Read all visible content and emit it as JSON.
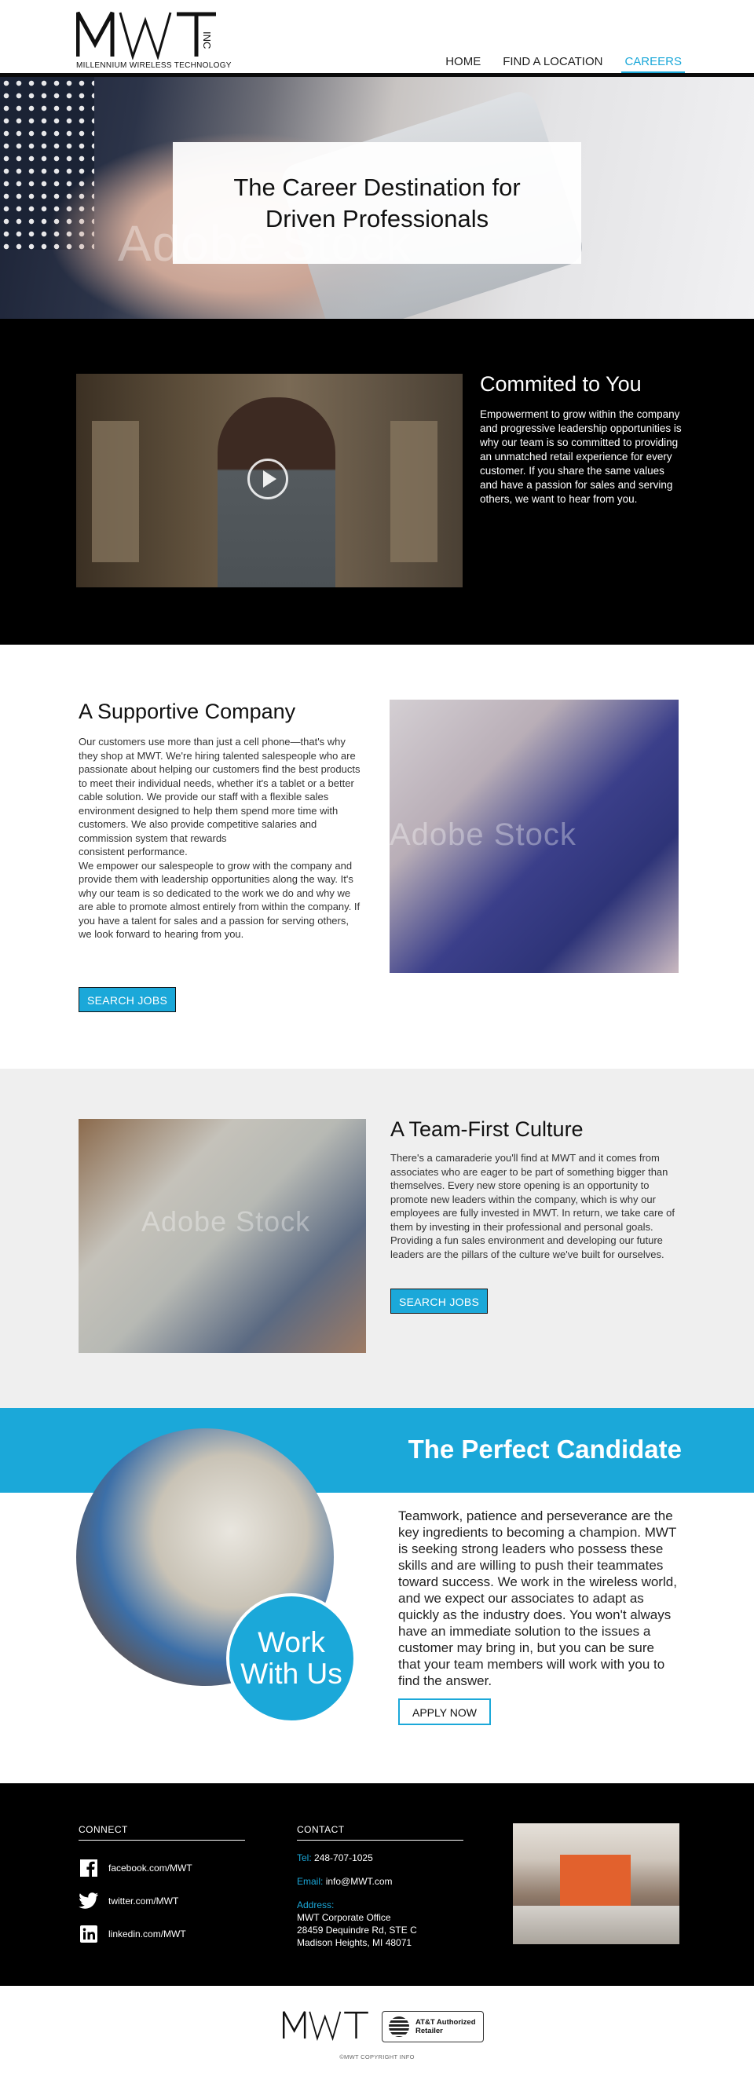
{
  "brand": {
    "logo_text": "MWT",
    "logo_inc": "INC",
    "logo_subtitle": "MILLENNIUM WIRELESS TECHNOLOGY",
    "accent_color": "#1ba8d9"
  },
  "nav": {
    "items": [
      {
        "label": "HOME",
        "active": false
      },
      {
        "label": "FIND A LOCATION",
        "active": false
      },
      {
        "label": "CAREERS",
        "active": true
      }
    ]
  },
  "hero": {
    "headline": "The Career Destination for Driven Professionals",
    "watermark": "Adobe Stock"
  },
  "committed": {
    "title": "Commited to You",
    "body": "Empowerment to grow within the company and progressive leadership opportunities is why our team is so committed to providing an unmatched retail experience for every customer. If you share the same values and have a passion for sales and serving others, we want to hear from you.",
    "video_icon": "play-icon"
  },
  "support": {
    "title": "A Supportive Company",
    "body_1": "Our customers use more than just a cell phone—that's why they shop at MWT. We're hiring talented salespeople who are passionate about helping our customers find the best products to meet their individual needs, whether it's a tablet or a better cable solution. We provide our staff with a flexible sales environment designed to help them spend more time with customers. We also provide competitive salaries and commission system that rewards",
    "body_2": "consistent performance.",
    "body_3": "We empower our salespeople to grow with the company and provide them with leadership opportunities along the way. It's why our team is so dedicated to the work we do and why we are able to promote almost entirely from within the company. If you have a talent for sales and a passion for serving others, we look forward to hearing from you.",
    "button": "SEARCH JOBS",
    "watermark": "Adobe Stock"
  },
  "team": {
    "title": "A Team-First Culture",
    "body": "There's a camaraderie you'll find at MWT and it comes from associates who are eager to be part of something bigger than themselves. Every new store opening is an opportunity to promote new leaders within the company, which is why our employees are fully invested in MWT. In return, we take care of them by investing in their professional and personal goals. Providing a fun sales environment and developing our future leaders are the pillars of the culture we've built for ourselves.",
    "button": "SEARCH JOBS",
    "watermark": "Adobe Stock"
  },
  "candidate": {
    "title": "The Perfect Candidate",
    "circle_text": "Work With Us",
    "body": "Teamwork, patience and perseverance are the key ingredients to becoming a champion. MWT is seeking strong leaders who possess these skills and are willing to push their teammates toward success. We work in the wireless world, and we expect our associates to adapt as quickly as the industry does. You won't always have an immediate solution to the issues a customer may bring in, but you can be sure that your team members will work with you to find the answer.",
    "button": "APPLY NOW"
  },
  "footer": {
    "connect_title": "CONNECT",
    "social": [
      {
        "icon": "facebook-icon",
        "label": "facebook.com/MWT"
      },
      {
        "icon": "twitter-icon",
        "label": "twitter.com/MWT"
      },
      {
        "icon": "linkedin-icon",
        "label": "linkedin.com/MWT"
      }
    ],
    "contact_title": "CONTACT",
    "tel_label": "Tel:",
    "tel": "248-707-1025",
    "email_label": "Email:",
    "email": "info@MWT.com",
    "address_label": "Address:",
    "address_1": "MWT Corporate Office",
    "address_2": "28459 Dequindre Rd, STE C",
    "address_3": "Madison Heights, MI 48071"
  },
  "bottom": {
    "att_line1": "AT&T Authorized",
    "att_line2": "Retailer",
    "copyright": "©MWT COPYRIGHT INFO"
  }
}
